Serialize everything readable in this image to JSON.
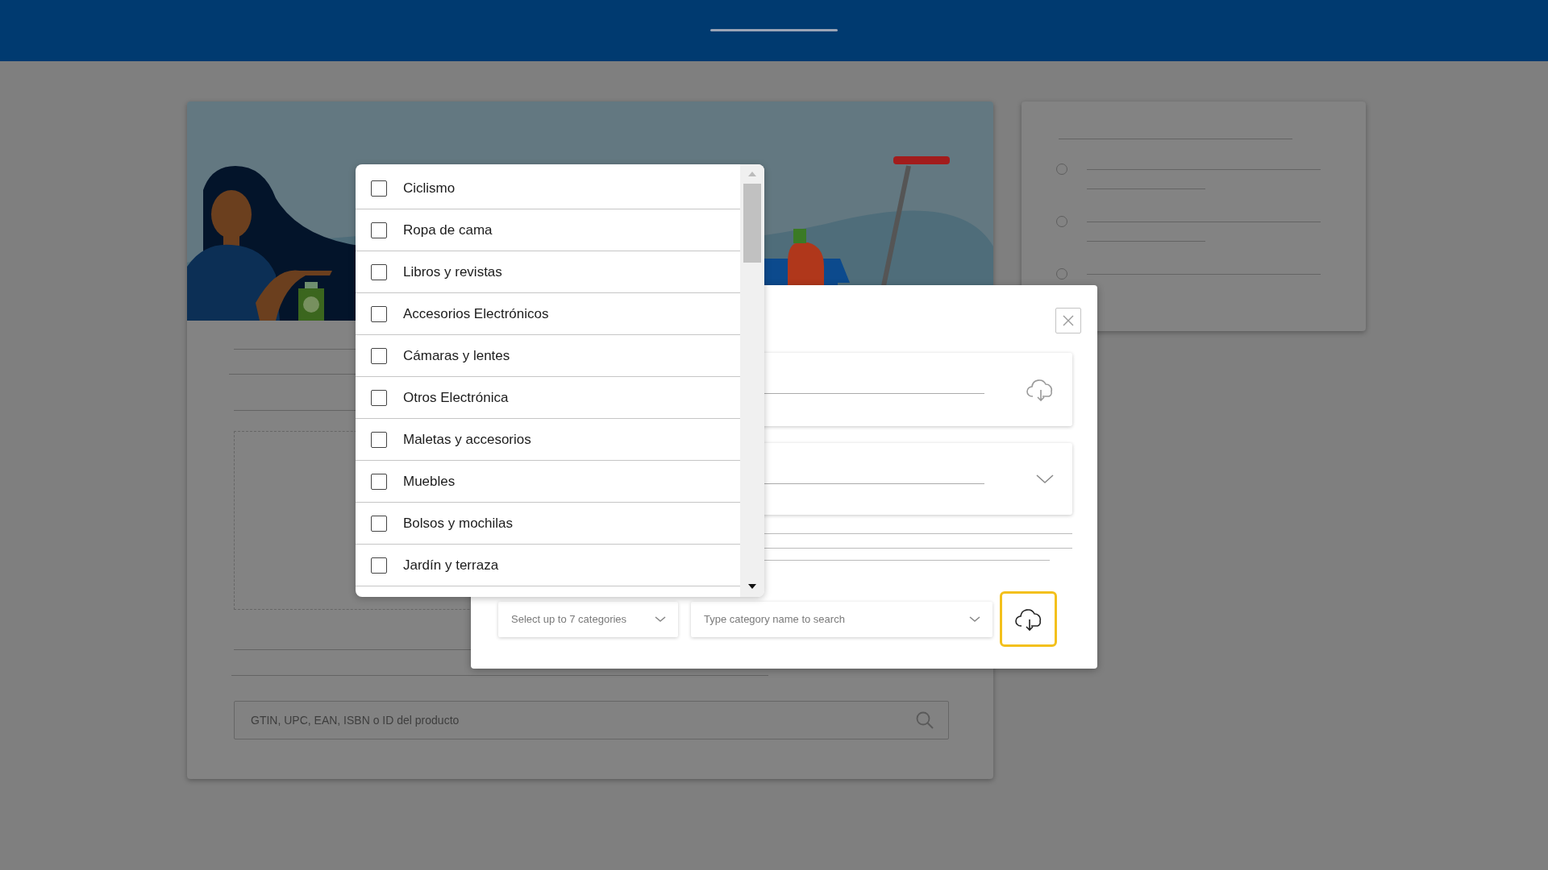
{
  "product_card": {
    "search": {
      "placeholder": "GTIN, UPC, EAN, ISBN o ID del producto"
    }
  },
  "side_card": {
    "options": [
      {
        "selected": false
      },
      {
        "selected": false
      },
      {
        "selected": false
      }
    ]
  },
  "upload_modal": {
    "category_select": {
      "placeholder": "Select up to 7 categories"
    },
    "category_search": {
      "placeholder": "Type category name to search"
    },
    "upload_button": {
      "focused": true
    }
  },
  "category_dropdown": {
    "options": [
      {
        "label": "Ciclismo",
        "checked": false
      },
      {
        "label": "Ropa de cama",
        "checked": false
      },
      {
        "label": "Libros y revistas",
        "checked": false
      },
      {
        "label": "Accesorios Electrónicos",
        "checked": false
      },
      {
        "label": "Cámaras y lentes",
        "checked": false
      },
      {
        "label": "Otros Electrónica",
        "checked": false
      },
      {
        "label": "Maletas y accesorios",
        "checked": false
      },
      {
        "label": "Muebles",
        "checked": false
      },
      {
        "label": "Bolsos y mochilas",
        "checked": false
      },
      {
        "label": "Jardín y terraza",
        "checked": false
      }
    ]
  }
}
